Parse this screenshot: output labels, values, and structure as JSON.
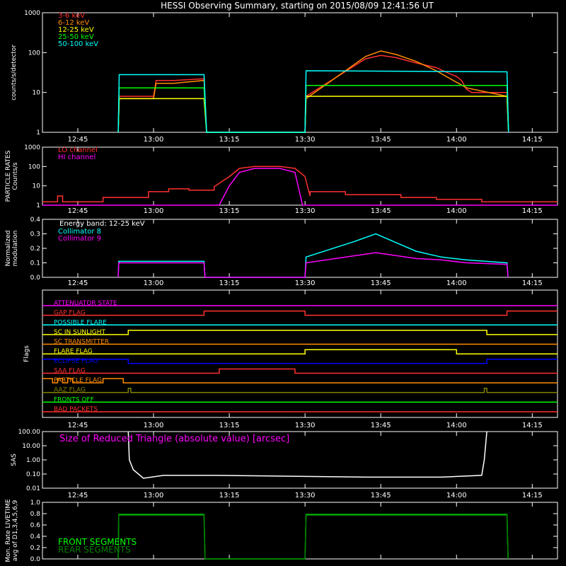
{
  "title": "HESSI Observing Summary, starting on 2015/08/09 12:41:56 UT",
  "time_axis": {
    "range_min": [
      -4,
      98
    ],
    "ticks": [
      {
        "min": 3,
        "label": "12:45"
      },
      {
        "min": 18,
        "label": "13:00"
      },
      {
        "min": 33,
        "label": "13:15"
      },
      {
        "min": 48,
        "label": "13:30"
      },
      {
        "min": 63,
        "label": "13:45"
      },
      {
        "min": 78,
        "label": "14:00"
      },
      {
        "min": 93,
        "label": "14:15"
      }
    ]
  },
  "chart_data": [
    {
      "type": "line",
      "id": "count-rates",
      "ylabel": "counts/s/detector",
      "yscale": "log",
      "ylim": [
        1,
        1000
      ],
      "yticks": [
        "1",
        "10",
        "100",
        "1000"
      ],
      "series": [
        {
          "name": "3-6 keV",
          "color": "#ff3030",
          "x": [
            11,
            11.2,
            17,
            18,
            18.5,
            22,
            28,
            28.5,
            48,
            48.2,
            60,
            63,
            66,
            70,
            74,
            76,
            78,
            79,
            80,
            81,
            88,
            88.3
          ],
          "y": [
            1,
            8,
            8,
            8,
            20,
            20,
            22,
            1,
            1,
            8,
            70,
            85,
            75,
            55,
            42,
            32,
            25,
            20,
            12,
            10,
            10,
            1
          ]
        },
        {
          "name": "6-12 keV",
          "color": "#ff8c00",
          "x": [
            11,
            11.2,
            17,
            18,
            18.5,
            22,
            28,
            28.5,
            48,
            48.2,
            60,
            63,
            66,
            70,
            74,
            76,
            78,
            80,
            88,
            88.3
          ],
          "y": [
            1,
            7,
            7,
            7,
            17,
            17,
            20,
            1,
            1,
            7,
            80,
            110,
            90,
            60,
            35,
            25,
            18,
            13,
            8,
            1
          ]
        },
        {
          "name": "12-25 keV",
          "color": "#ffff00",
          "x": [
            11,
            11.2,
            28,
            28.5,
            48,
            48.2,
            88,
            88.3
          ],
          "y": [
            1,
            7,
            7,
            1,
            1,
            8,
            8,
            1
          ]
        },
        {
          "name": "25-50 keV",
          "color": "#00ff00",
          "x": [
            11,
            11.2,
            28,
            28.5,
            48,
            48.2,
            88,
            88.3
          ],
          "y": [
            1,
            13,
            13,
            1,
            1,
            15,
            15,
            1
          ]
        },
        {
          "name": "50-100 keV",
          "color": "#00ffff",
          "x": [
            11,
            11.2,
            28,
            28.5,
            48,
            48.2,
            88,
            88.3
          ],
          "y": [
            1,
            28,
            28,
            1,
            1,
            35,
            33,
            1
          ]
        }
      ]
    },
    {
      "type": "line",
      "id": "particle-rates",
      "ylabel": "PARTICLE RATES",
      "ylabel2": "Counts/s",
      "yscale": "log",
      "ylim": [
        1,
        1000
      ],
      "yticks": [
        "1",
        "10",
        "100",
        "1000"
      ],
      "series": [
        {
          "name": "LO channel",
          "color": "#ff3030",
          "x": [
            -4,
            -1,
            -1,
            0,
            0,
            8,
            8,
            17,
            17,
            21,
            21,
            25,
            25,
            30,
            30,
            33,
            35,
            38,
            43,
            46,
            48,
            48.5,
            49,
            49,
            56,
            56,
            67,
            67,
            74,
            74,
            83,
            83,
            98
          ],
          "y": [
            1.5,
            1.5,
            3,
            3,
            1.5,
            1.5,
            2.5,
            2.5,
            5,
            5,
            7,
            7,
            6,
            6,
            9,
            30,
            80,
            100,
            100,
            80,
            30,
            9,
            3,
            5,
            5,
            3.5,
            3.5,
            2.5,
            2.5,
            2,
            2,
            1.5,
            1.5
          ]
        },
        {
          "name": "HI channel",
          "color": "#ff00ff",
          "x": [
            -4,
            31,
            33,
            35,
            38,
            43,
            46,
            47.5,
            98
          ],
          "y": [
            1,
            1,
            10,
            50,
            80,
            80,
            50,
            1,
            1
          ]
        }
      ]
    },
    {
      "type": "line",
      "id": "modulation",
      "ylabel": "Normalized",
      "ylabel2": "modulation",
      "ylim": [
        0,
        0.4
      ],
      "yticks": [
        "0.0",
        "0.1",
        "0.2",
        "0.3",
        "0.4"
      ],
      "annotation": "Energy band: 12-25 keV",
      "series": [
        {
          "name": "Collimator 8",
          "color": "#00ffff",
          "x": [
            11,
            11.1,
            28,
            28.2,
            48,
            48.2,
            58,
            62,
            66,
            70,
            75,
            80,
            88,
            88.2
          ],
          "y": [
            0,
            0.11,
            0.11,
            0,
            0,
            0.14,
            0.25,
            0.3,
            0.24,
            0.18,
            0.14,
            0.12,
            0.1,
            0
          ]
        },
        {
          "name": "Collimator 9",
          "color": "#ff00ff",
          "x": [
            11,
            11.1,
            28,
            28.2,
            48,
            48.2,
            58,
            62,
            66,
            70,
            75,
            80,
            88,
            88.2
          ],
          "y": [
            0,
            0.1,
            0.1,
            0,
            0,
            0.1,
            0.15,
            0.17,
            0.15,
            0.13,
            0.12,
            0.1,
            0.09,
            0
          ]
        }
      ]
    },
    {
      "type": "line",
      "id": "flags",
      "ylabel": "Flags",
      "series": [
        {
          "name": "ATTENUATOR STATE",
          "color": "#ff00ff",
          "x": [
            -4,
            98
          ],
          "y": [
            0,
            0
          ]
        },
        {
          "name": "GAP FLAG",
          "color": "#ff3030",
          "x": [
            -4,
            28,
            28,
            48,
            48,
            88,
            88,
            98
          ],
          "y": [
            0,
            0,
            1,
            1,
            0,
            0,
            1,
            1
          ]
        },
        {
          "name": "POSSIBLE FLARE",
          "color": "#00ffff",
          "x": [
            -4,
            98
          ],
          "y": [
            0,
            0
          ]
        },
        {
          "name": "SC IN SUNLIGHT",
          "color": "#ffff00",
          "x": [
            -4,
            13,
            13,
            84,
            84,
            98
          ],
          "y": [
            0,
            0,
            1,
            1,
            0,
            0
          ]
        },
        {
          "name": "SC TRANSMITTER",
          "color": "#ff8c00",
          "x": [
            -4,
            98
          ],
          "y": [
            0,
            0
          ]
        },
        {
          "name": "FLARE FLAG",
          "color": "#ffff00",
          "x": [
            -4,
            48,
            48,
            78,
            78,
            98
          ],
          "y": [
            0,
            0,
            1,
            1,
            0,
            0
          ]
        },
        {
          "name": "ECLIPSE FLAG",
          "color": "#0000ff",
          "x": [
            -4,
            13,
            13,
            84,
            84,
            98
          ],
          "y": [
            1,
            1,
            0,
            0,
            1,
            1
          ]
        },
        {
          "name": "SAA FLAG",
          "color": "#ff3030",
          "x": [
            -4,
            31,
            31,
            46,
            46,
            98
          ],
          "y": [
            0,
            0,
            1,
            1,
            0,
            0
          ]
        },
        {
          "name": "PARTICLE FLAG",
          "color": "#ff8c00",
          "x": [
            -4,
            -2,
            -2,
            -1,
            -1,
            0,
            0,
            1,
            1,
            2,
            2,
            8,
            8,
            12,
            12,
            98
          ],
          "y": [
            1,
            1,
            0,
            0,
            1,
            1,
            0,
            0,
            1,
            1,
            0,
            0,
            1,
            1,
            0,
            0
          ]
        },
        {
          "name": "AAZ FLAG",
          "color": "#808000",
          "x": [
            -4,
            13,
            13,
            13.5,
            13.5,
            83.5,
            83.5,
            84,
            84,
            98
          ],
          "y": [
            0,
            0,
            1,
            1,
            0,
            0,
            1,
            1,
            0,
            0
          ]
        },
        {
          "name": "FRONTS OFF",
          "color": "#00ff00",
          "x": [
            -4,
            98
          ],
          "y": [
            0,
            0
          ]
        },
        {
          "name": "BAD PACKETS",
          "color": "#ff3030",
          "x": [
            -4,
            98
          ],
          "y": [
            0,
            0
          ]
        }
      ]
    },
    {
      "type": "line",
      "id": "sas",
      "ylabel": "SAS",
      "yscale": "log",
      "ylim": [
        0.01,
        100
      ],
      "yticks": [
        "0.01",
        "0.10",
        "1.00",
        "10.00",
        "100.00"
      ],
      "annotation": "Size of Reduced Triangle (absolute value) [arcsec]",
      "series": [
        {
          "name": "",
          "color": "#ffffff",
          "x": [
            13,
            13.2,
            14,
            16,
            20,
            30,
            45,
            60,
            75,
            83,
            83.5,
            84
          ],
          "y": [
            100,
            1,
            0.2,
            0.05,
            0.08,
            0.08,
            0.07,
            0.06,
            0.06,
            0.08,
            1,
            100
          ]
        }
      ]
    },
    {
      "type": "line",
      "id": "livetime",
      "ylabel": "Mon. Rate LIVETIME",
      "ylabel2": "avg of D1,3,4,5,6,9",
      "ylim": [
        0,
        1
      ],
      "yticks": [
        "0.0",
        "0.2",
        "0.4",
        "0.6",
        "0.8",
        "1.0"
      ],
      "series": [
        {
          "name": "FRONT SEGMENTS",
          "color": "#00ff00",
          "x": [
            11,
            11.1,
            28,
            28.2,
            48,
            48.2,
            88,
            88.2
          ],
          "y": [
            0,
            0.78,
            0.78,
            0,
            0,
            0.78,
            0.78,
            0
          ]
        },
        {
          "name": "REAR SEGMENTS",
          "color": "#008000",
          "x": [
            11,
            11.1,
            28,
            28.2,
            48,
            48.2,
            88,
            88.2
          ],
          "y": [
            0,
            0.79,
            0.79,
            0,
            0,
            0.79,
            0.79,
            0
          ]
        }
      ]
    }
  ]
}
